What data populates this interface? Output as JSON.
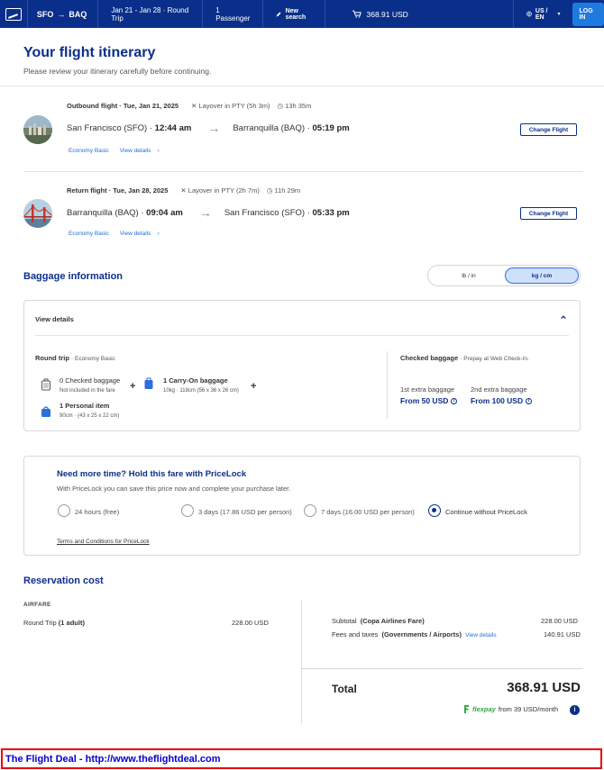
{
  "header": {
    "origin": "SFO",
    "destination": "BAQ",
    "dates": "Jan 21 - Jan 28 · Round Trip",
    "passengers": "1 Passenger",
    "new_search": "New search",
    "total": "368.91 USD",
    "locale": "US / EN",
    "login": "LOG IN",
    "colors": {
      "brand": "#0a2f8a",
      "accent": "#1f7ae0"
    }
  },
  "page": {
    "title": "Your flight itinerary",
    "subtitle": "Please review your itinerary carefully before continuing."
  },
  "outbound": {
    "label": "Outbound flight · Tue, Jan 21, 2025",
    "layover": "Layover in PTY (5h 3m)",
    "duration": "13h 35m",
    "from_city": "San Francisco (SFO) ·",
    "from_time": "12:44 am",
    "to_city": "Barranquilla (BAQ) ·",
    "to_time": "05:19 pm",
    "fare": "Economy Basic",
    "details": "View details",
    "change": "Change Flight"
  },
  "return": {
    "label": "Return flight · Tue, Jan 28, 2025",
    "layover": "Layover in PTY (2h 7m)",
    "duration": "11h 29m",
    "from_city": "Barranquilla (BAQ) ·",
    "from_time": "09:04 am",
    "to_city": "San Francisco (SFO) ·",
    "to_time": "05:33 pm",
    "fare": "Economy Basic",
    "details": "View details",
    "change": "Change Flight"
  },
  "baggage": {
    "title": "Baggage information",
    "unit_lb": "lb / in",
    "unit_kg": "kg / cm",
    "view_details": "View details",
    "round_trip": "Round trip",
    "fare": "· Economy Basic",
    "checked_count": "0 Checked baggage",
    "checked_note": "Not included in the fare",
    "carry_on": "1 Carry-On baggage",
    "carry_on_dims": "10kg · 118cm (56 x 36 x 26 cm)",
    "personal": "1 Personal item",
    "personal_dims": "90cm · (43 x 25 x 22 cm)",
    "checked_title": "Checked baggage",
    "checked_sub": "· Prepay at Web Check-In.",
    "extra1_label": "1st extra baggage",
    "extra1_value": "From 50 USD",
    "extra2_label": "2nd extra baggage",
    "extra2_value": "From 100 USD"
  },
  "pricelock": {
    "title": "Need more time? Hold this fare with PriceLock",
    "desc": "With PriceLock you can save this price now and complete your purchase later.",
    "options": [
      {
        "label": "24 hours (free)",
        "selected": false
      },
      {
        "label": "3 days (17.86 USD per person)",
        "selected": false
      },
      {
        "label": "7 days (16.00 USD per person)",
        "selected": false
      },
      {
        "label": "Continue without PriceLock",
        "selected": true
      }
    ],
    "terms": "Terms and Conditions for PriceLock"
  },
  "reservation": {
    "title": "Reservation cost",
    "airfare_label": "AIRFARE",
    "round_trip_label": "Round Trip",
    "round_trip_qty": "(1 adult)",
    "round_trip_value": "228.00 USD",
    "subtotal_label": "Subtotal",
    "subtotal_note": "(Copa Airlines Fare)",
    "subtotal_value": "228.00 USD",
    "fees_label": "Fees and taxes",
    "fees_note": "(Governments / Airports)",
    "fees_link": "View details",
    "fees_value": "140.91 USD",
    "total_label": "Total",
    "total_value": "368.91 USD",
    "flexpay_brand": "flexpay",
    "flexpay_text": "from 39 USD/month"
  },
  "footer": {
    "banner": "The Flight Deal - http://www.theflightdeal.com"
  }
}
